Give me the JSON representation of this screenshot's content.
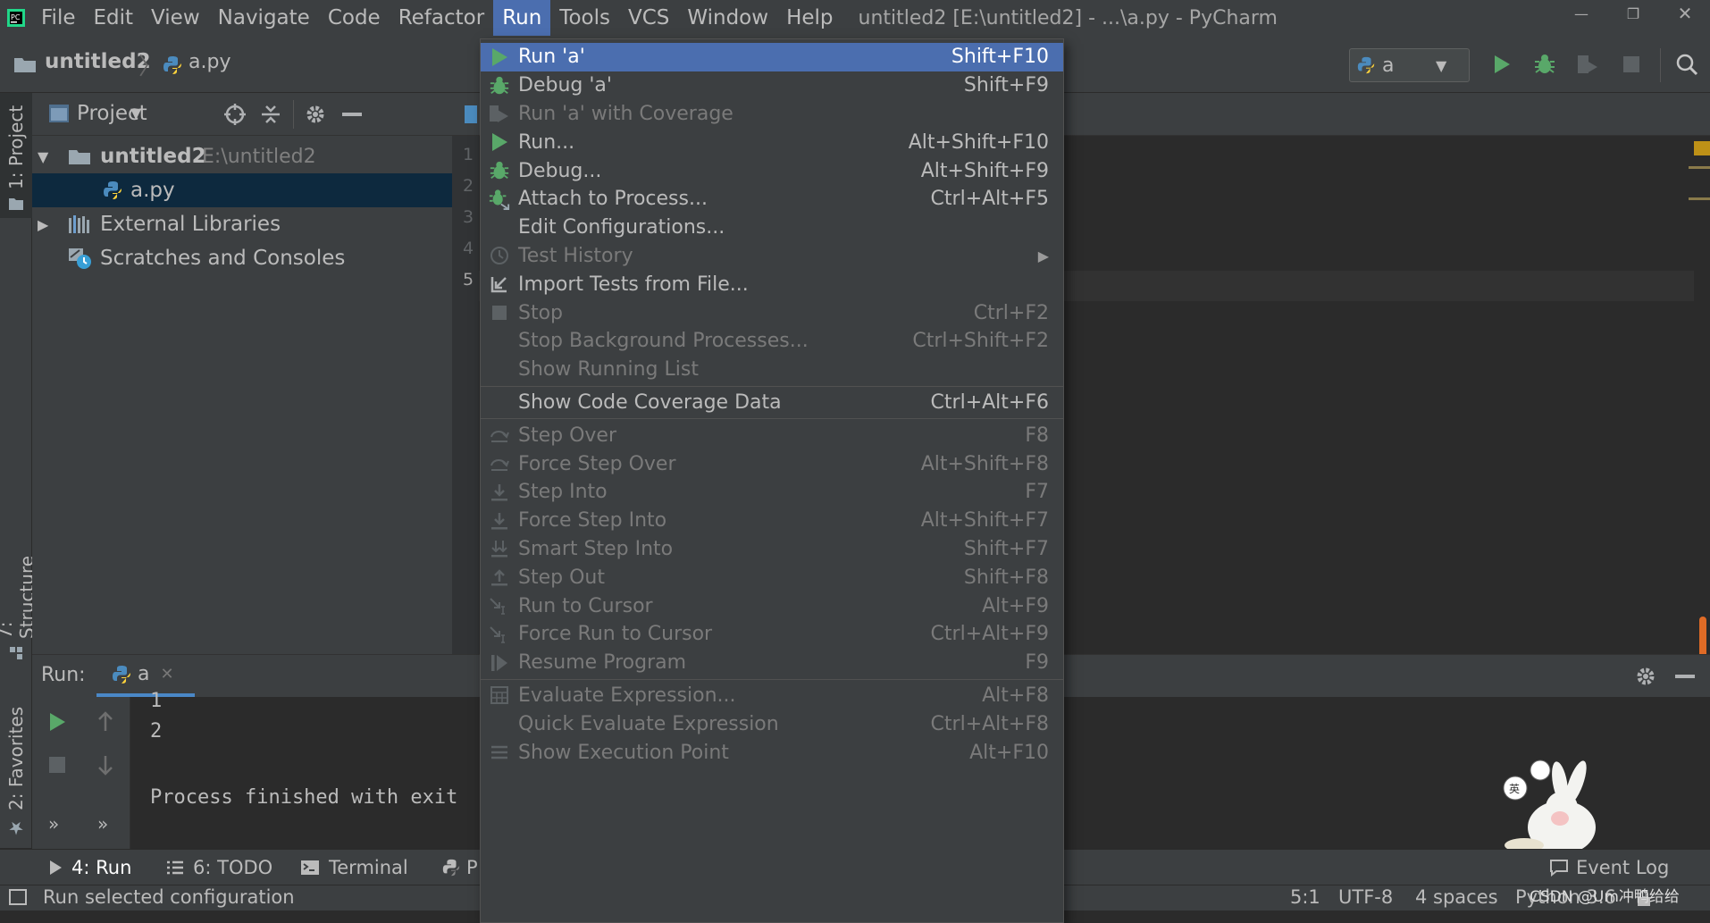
{
  "menubar": {
    "items": [
      "File",
      "Edit",
      "View",
      "Navigate",
      "Code",
      "Refactor",
      "Run",
      "Tools",
      "VCS",
      "Window",
      "Help"
    ],
    "active": "Run",
    "window_title": "untitled2 [E:\\untitled2] - ...\\a.py - PyCharm"
  },
  "navbar": {
    "breadcrumb_project": "untitled2",
    "breadcrumb_file": "a.py",
    "run_config": "a"
  },
  "left_strip": {
    "project_tab": "1: Project",
    "structure_tab": "7: Structure",
    "favorites_tab": "2: Favorites"
  },
  "project_panel": {
    "title": "Project",
    "tree": {
      "root_name": "untitled2",
      "root_path": "E:\\untitled2",
      "file": "a.py",
      "external_libraries": "External Libraries",
      "scratches": "Scratches and Consoles"
    }
  },
  "editor": {
    "line_numbers": [
      "1",
      "2",
      "3",
      "4",
      "5"
    ]
  },
  "run_panel": {
    "label": "Run:",
    "tab": "a",
    "console_lines": [
      "1",
      "2",
      "",
      "Process finished with exit"
    ],
    "more_left": "»",
    "more_right": "»"
  },
  "bottom_tabs": {
    "run": "4: Run",
    "todo": "6: TODO",
    "terminal": "Terminal",
    "python_console_partial": "P",
    "event_log": "Event Log"
  },
  "status": {
    "message": "Run selected configuration",
    "position": "5:1",
    "encoding": "UTF-8",
    "indent": "4 spaces",
    "interpreter": "Python 3.6",
    "watermark": "CSDN @Um冲鸭给给"
  },
  "run_menu": {
    "items": [
      {
        "label": "Run 'a'",
        "shortcut": "Shift+F10",
        "icon": "run-icon",
        "enabled": true,
        "selected": true
      },
      {
        "label": "Debug 'a'",
        "shortcut": "Shift+F9",
        "icon": "debug-icon",
        "enabled": true
      },
      {
        "label": "Run 'a' with Coverage",
        "shortcut": "",
        "icon": "coverage-icon",
        "enabled": false
      },
      {
        "label": "Run...",
        "shortcut": "Alt+Shift+F10",
        "icon": "run-icon",
        "enabled": true
      },
      {
        "label": "Debug...",
        "shortcut": "Alt+Shift+F9",
        "icon": "debug-icon",
        "enabled": true
      },
      {
        "label": "Attach to Process...",
        "shortcut": "Ctrl+Alt+F5",
        "icon": "attach-icon",
        "enabled": true
      },
      {
        "label": "Edit Configurations...",
        "shortcut": "",
        "icon": "",
        "enabled": true
      },
      {
        "label": "Test History",
        "shortcut": "",
        "icon": "clock-icon",
        "enabled": false,
        "submenu": true
      },
      {
        "label": "Import Tests from File...",
        "shortcut": "",
        "icon": "import-icon",
        "enabled": true
      },
      {
        "label": "Stop",
        "shortcut": "Ctrl+F2",
        "icon": "stop-icon",
        "enabled": false
      },
      {
        "label": "Stop Background Processes...",
        "shortcut": "Ctrl+Shift+F2",
        "icon": "",
        "enabled": false
      },
      {
        "label": "Show Running List",
        "shortcut": "",
        "icon": "",
        "enabled": false
      },
      {
        "label": "Show Code Coverage Data",
        "shortcut": "Ctrl+Alt+F6",
        "icon": "",
        "enabled": true,
        "separator_before": true
      },
      {
        "label": "Step Over",
        "shortcut": "F8",
        "icon": "step-over-icon",
        "enabled": false,
        "separator_before": true
      },
      {
        "label": "Force Step Over",
        "shortcut": "Alt+Shift+F8",
        "icon": "force-step-over-icon",
        "enabled": false
      },
      {
        "label": "Step Into",
        "shortcut": "F7",
        "icon": "step-into-icon",
        "enabled": false
      },
      {
        "label": "Force Step Into",
        "shortcut": "Alt+Shift+F7",
        "icon": "force-step-into-icon",
        "enabled": false
      },
      {
        "label": "Smart Step Into",
        "shortcut": "Shift+F7",
        "icon": "smart-step-into-icon",
        "enabled": false
      },
      {
        "label": "Step Out",
        "shortcut": "Shift+F8",
        "icon": "step-out-icon",
        "enabled": false
      },
      {
        "label": "Run to Cursor",
        "shortcut": "Alt+F9",
        "icon": "run-to-cursor-icon",
        "enabled": false
      },
      {
        "label": "Force Run to Cursor",
        "shortcut": "Ctrl+Alt+F9",
        "icon": "force-run-to-cursor-icon",
        "enabled": false
      },
      {
        "label": "Resume Program",
        "shortcut": "F9",
        "icon": "resume-icon",
        "enabled": false
      },
      {
        "label": "Evaluate Expression...",
        "shortcut": "Alt+F8",
        "icon": "calculator-icon",
        "enabled": false,
        "separator_before": true
      },
      {
        "label": "Quick Evaluate Expression",
        "shortcut": "Ctrl+Alt+F8",
        "icon": "",
        "enabled": false
      },
      {
        "label": "Show Execution Point",
        "shortcut": "Alt+F10",
        "icon": "execution-point-icon",
        "enabled": false
      }
    ]
  },
  "colors": {
    "accent": "#4b6eaf",
    "run_green": "#59a869",
    "panel_bg": "#3c3f41",
    "editor_bg": "#2b2b2b",
    "selection_dark": "#0d293e"
  }
}
